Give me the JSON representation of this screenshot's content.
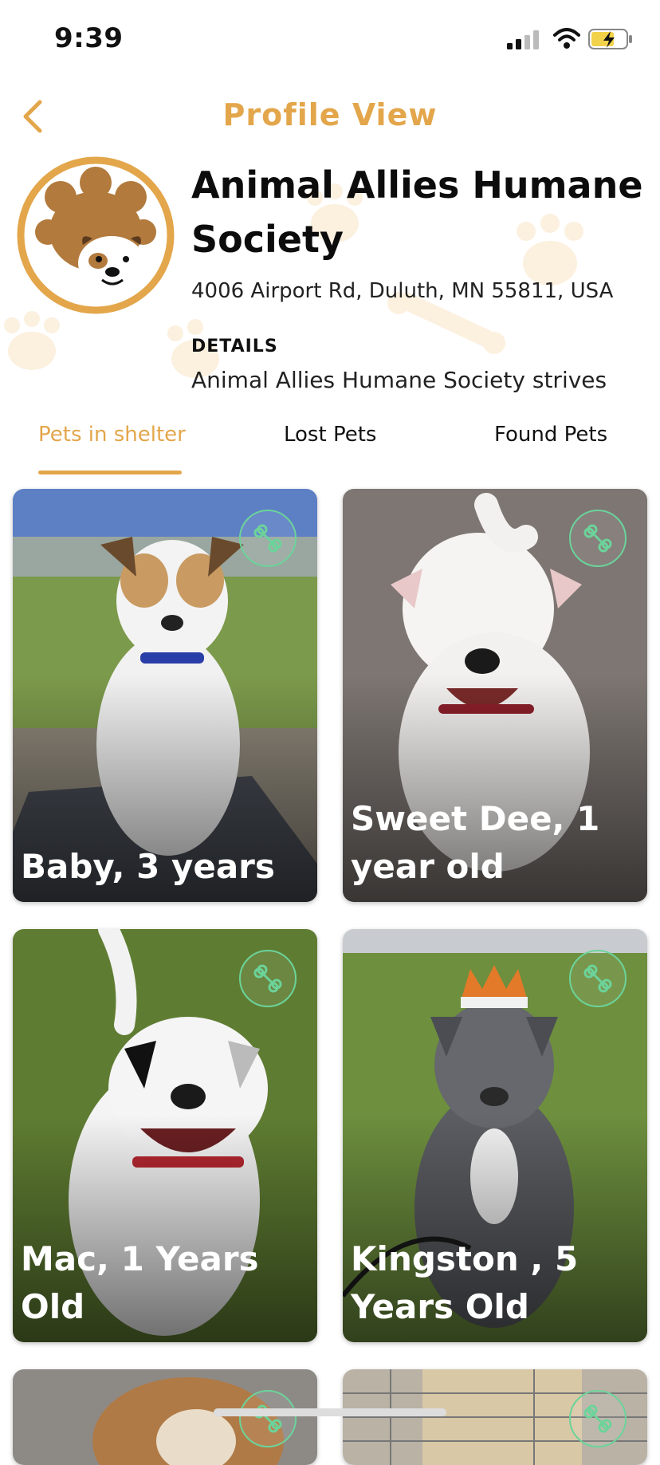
{
  "status_bar": {
    "time": "9:39"
  },
  "header": {
    "title": "Profile View"
  },
  "shelter": {
    "name": "Animal Allies Humane Society",
    "address": "4006 Airport Rd, Duluth, MN 55811, USA",
    "details_heading": "DETAILS",
    "details_text": "Animal Allies Humane Society strives"
  },
  "tabs": [
    {
      "label": "Pets in shelter",
      "active": true
    },
    {
      "label": "Lost Pets",
      "active": false
    },
    {
      "label": "Found Pets",
      "active": false
    }
  ],
  "pets": [
    {
      "name": "Baby, 3 years"
    },
    {
      "name": "Sweet Dee, 1 year old"
    },
    {
      "name": "Mac, 1 Years Old"
    },
    {
      "name": "Kingston , 5 Years Old"
    }
  ],
  "colors": {
    "accent": "#E3A64B",
    "bone_icon": "#6CD39A"
  }
}
